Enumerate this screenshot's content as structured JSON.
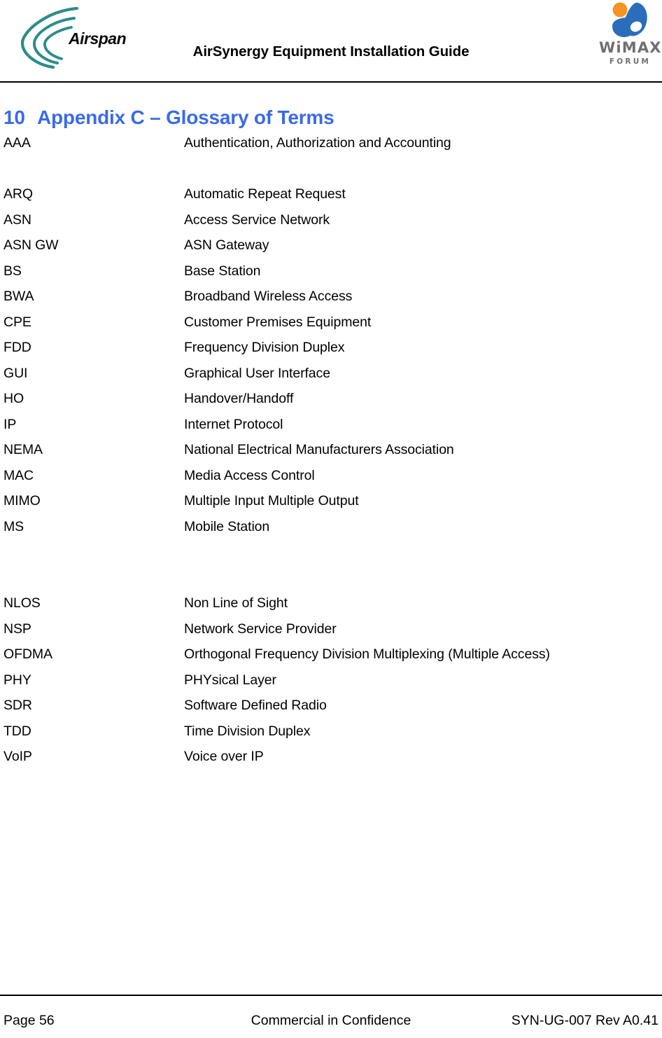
{
  "header": {
    "airspan_logo_alt": "Airspan",
    "airspan_wordmark": "Airspan",
    "title": "AirSynergy Equipment Installation Guide",
    "wimax_word": "WiMAX",
    "wimax_sub": "FORUM",
    "colors": {
      "airspan_arc": "#2e8b8b",
      "wimax_blue": "#2a6ebb",
      "wimax_orange": "#f59323",
      "wimax_gray": "#6f6f6f"
    }
  },
  "heading": {
    "number": "10",
    "text": "Appendix C  – Glossary of Terms",
    "color": "#3a6ae8"
  },
  "glossary": {
    "rows": [
      {
        "term": "AAA",
        "definition": "Authentication, Authorization and Accounting"
      },
      {
        "term": "",
        "definition": ""
      },
      {
        "term": "ARQ",
        "definition": "Automatic Repeat Request"
      },
      {
        "term": "ASN",
        "definition": "Access Service Network"
      },
      {
        "term": "ASN GW",
        "definition": "ASN Gateway"
      },
      {
        "term": "BS",
        "definition": "Base Station"
      },
      {
        "term": "BWA",
        "definition": "Broadband Wireless Access"
      },
      {
        "term": "CPE",
        "definition": "Customer Premises Equipment"
      },
      {
        "term": "FDD",
        "definition": "Frequency Division Duplex"
      },
      {
        "term": "GUI",
        "definition": "Graphical User Interface"
      },
      {
        "term": "HO",
        "definition": "Handover/Handoff"
      },
      {
        "term": "IP",
        "definition": "Internet Protocol"
      },
      {
        "term": "NEMA",
        "definition": "National Electrical Manufacturers Association"
      },
      {
        "term": "MAC",
        "definition": "Media Access Control"
      },
      {
        "term": "MIMO",
        "definition": "Multiple Input Multiple Output"
      },
      {
        "term": "MS",
        "definition": "Mobile Station"
      },
      {
        "term": "",
        "definition": ""
      },
      {
        "term": "",
        "definition": ""
      },
      {
        "term": "NLOS",
        "definition": "Non Line of Sight"
      },
      {
        "term": "NSP",
        "definition": "Network Service Provider"
      },
      {
        "term": "OFDMA",
        "definition": "Orthogonal Frequency Division Multiplexing (Multiple Access)"
      },
      {
        "term": "PHY",
        "definition": "PHYsical Layer"
      },
      {
        "term": "SDR",
        "definition": "Software Defined Radio"
      },
      {
        "term": "TDD",
        "definition": "Time Division Duplex"
      },
      {
        "term": "VoIP",
        "definition": "Voice over IP"
      }
    ]
  },
  "footer": {
    "left": "Page 56",
    "center": "Commercial in Confidence",
    "right": "SYN-UG-007 Rev A0.41"
  }
}
